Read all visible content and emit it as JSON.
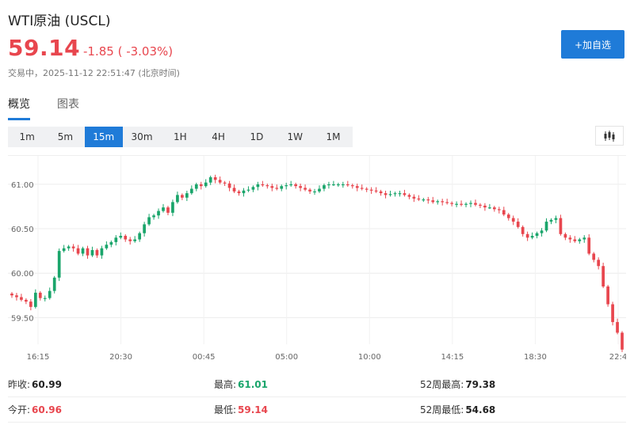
{
  "header": {
    "title": "WTI原油 (USCL)",
    "price": "59.14",
    "change": "-1.85 ( -3.03%)",
    "status": "交易中，2025-11-12 22:51:47 (北京时间)",
    "add_button": "+加自选"
  },
  "tabs": [
    {
      "label": "概览",
      "active": true
    },
    {
      "label": "图表",
      "active": false
    }
  ],
  "periods": [
    {
      "label": "1m"
    },
    {
      "label": "5m"
    },
    {
      "label": "15m",
      "active": true
    },
    {
      "label": "30m"
    },
    {
      "label": "1H"
    },
    {
      "label": "4H"
    },
    {
      "label": "1D"
    },
    {
      "label": "1W"
    },
    {
      "label": "1M"
    }
  ],
  "chart_type_icon": "candlestick-icon",
  "colors": {
    "accent": "#1f7bd8",
    "up": "#1aa56b",
    "down": "#e8464e"
  },
  "stats": [
    {
      "label": "昨收:",
      "value": "60.99",
      "tone": "neutral"
    },
    {
      "label": "最高:",
      "value": "61.01",
      "tone": "up"
    },
    {
      "label": "52周最高:",
      "value": "79.38",
      "tone": "neutral"
    },
    {
      "label": "今开:",
      "value": "60.96",
      "tone": "down"
    },
    {
      "label": "最低:",
      "value": "59.14",
      "tone": "down"
    },
    {
      "label": "52周最低:",
      "value": "54.68",
      "tone": "neutral"
    }
  ],
  "chart_data": {
    "type": "candlestick",
    "ylim": [
      59.2,
      61.32
    ],
    "y_ticks": [
      "61.00",
      "60.50",
      "60.00",
      "59.50"
    ],
    "x_ticks": [
      "16:15",
      "20:30",
      "00:45",
      "05:00",
      "10:00",
      "14:15",
      "18:30",
      "22:4"
    ],
    "grid": true,
    "closes": [
      59.75,
      59.73,
      59.7,
      59.68,
      59.62,
      59.78,
      59.72,
      59.72,
      59.8,
      59.95,
      60.25,
      60.28,
      60.3,
      60.28,
      60.22,
      60.28,
      60.2,
      60.26,
      60.2,
      60.28,
      60.32,
      60.35,
      60.4,
      60.42,
      60.38,
      60.36,
      60.38,
      60.45,
      60.55,
      60.63,
      60.65,
      60.7,
      60.74,
      60.68,
      60.8,
      60.88,
      60.85,
      60.9,
      60.95,
      61.0,
      60.98,
      61.02,
      61.08,
      61.05,
      61.02,
      61.01,
      60.96,
      60.92,
      60.9,
      60.93,
      60.94,
      60.97,
      61.0,
      60.99,
      60.98,
      60.96,
      60.95,
      60.98,
      60.99,
      61.0,
      60.98,
      60.96,
      60.94,
      60.92,
      60.92,
      60.95,
      60.99,
      61.0,
      61.0,
      61.0,
      61.0,
      60.99,
      60.98,
      60.96,
      60.95,
      60.94,
      60.93,
      60.92,
      60.9,
      60.88,
      60.89,
      60.9,
      60.9,
      60.88,
      60.86,
      60.84,
      60.83,
      60.83,
      60.82,
      60.8,
      60.81,
      60.8,
      60.79,
      60.78,
      60.78,
      60.77,
      60.78,
      60.79,
      60.77,
      60.76,
      60.74,
      60.74,
      60.72,
      60.71,
      60.66,
      60.62,
      60.58,
      60.52,
      60.44,
      60.4,
      60.42,
      60.45,
      60.48,
      60.58,
      60.6,
      60.62,
      60.44,
      60.4,
      60.38,
      60.36,
      60.38,
      60.4,
      60.22,
      60.15,
      60.08,
      59.85,
      59.65,
      59.45,
      59.33,
      59.14
    ]
  }
}
